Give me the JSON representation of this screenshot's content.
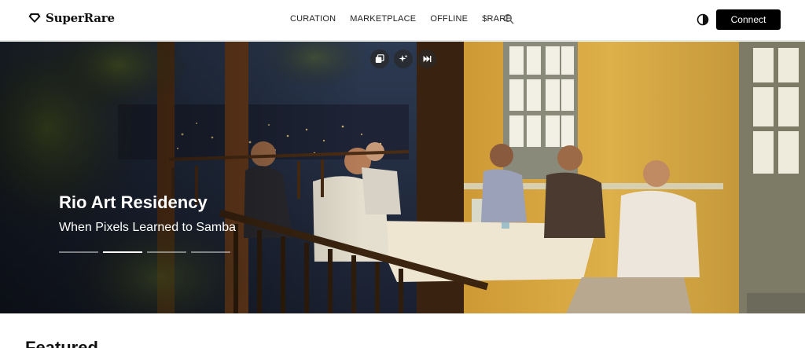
{
  "brand": {
    "name": "SuperRare",
    "icon": "diamond-logo-icon"
  },
  "nav": {
    "items": [
      {
        "label": "CURATION"
      },
      {
        "label": "MARKETPLACE"
      },
      {
        "label": "OFFLINE"
      },
      {
        "label": "$RARE"
      }
    ],
    "search_icon": "search-icon",
    "theme_icon": "contrast-icon",
    "connect_label": "Connect"
  },
  "hero": {
    "title": "Rio Art Residency",
    "subtitle": "When Pixels Learned to Samba",
    "controls": [
      "gallery-icon",
      "sparkle-icon",
      "skip-forward-icon"
    ],
    "slides_count": 4,
    "active_slide": 2
  },
  "section": {
    "title": "Featured"
  },
  "colors": {
    "accent": "#000000",
    "background": "#ffffff",
    "hero_wall": "#d8a93c"
  }
}
